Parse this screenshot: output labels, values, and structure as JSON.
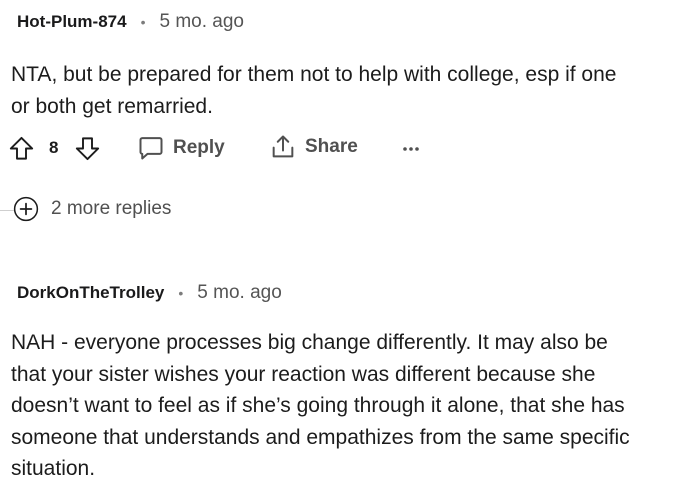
{
  "comments": [
    {
      "author": "Hot-Plum-874",
      "separator": "•",
      "time": "5 mo. ago",
      "body_lines": [
        "NTA, but be prepared for them not to help with college, esp if one",
        "or both get remarried."
      ],
      "score": "8",
      "actions": {
        "upvote_icon": "arrow-up-outline-icon",
        "downvote_icon": "arrow-down-outline-icon",
        "reply_label": "Reply",
        "reply_icon": "speech-bubble-icon",
        "share_label": "Share",
        "share_icon": "share-upload-icon",
        "more_label": "•••"
      },
      "more_replies": {
        "icon": "plus-circle-icon",
        "label": "2 more replies"
      }
    },
    {
      "author": "DorkOnTheTrolley",
      "separator": "•",
      "time": "5 mo. ago",
      "body_lines": [
        "NAH - everyone processes big change differently. It may also be",
        "that your sister wishes your reaction was different because she",
        "doesn’t want to feel as if she’s going through it alone, that she has",
        "someone that understands and empathizes from the same specific",
        "situation."
      ]
    }
  ],
  "colors": {
    "text": "#1c1c1c",
    "muted": "#505050",
    "divider": "#cfcfcf"
  }
}
